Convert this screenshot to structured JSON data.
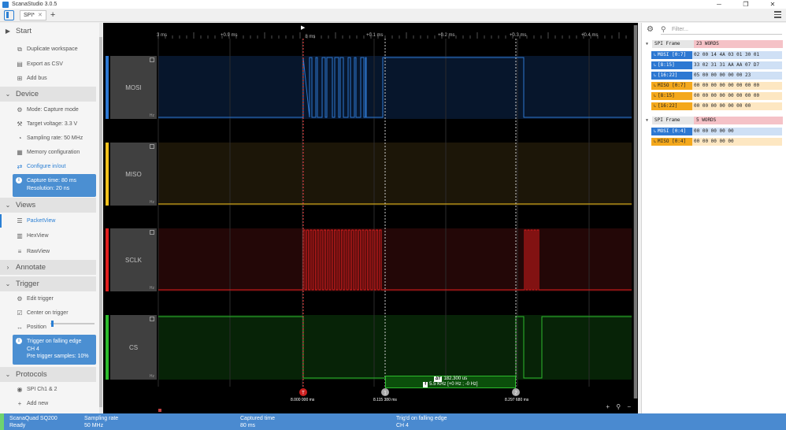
{
  "window": {
    "title": "ScanaStudio 3.0.5",
    "tab_label": "SPI*",
    "tab_close": "✕",
    "add_tab": "+",
    "minimize": "─",
    "maximize": "❐",
    "close": "✕"
  },
  "sidebar": {
    "start": {
      "title": "Start"
    },
    "start_items": [
      {
        "label": "Duplicate workspace",
        "icon": "duplicate-icon"
      },
      {
        "label": "Export as CSV",
        "icon": "export-icon"
      },
      {
        "label": "Add bus",
        "icon": "bus-icon"
      }
    ],
    "device": {
      "title": "Device"
    },
    "device_items": [
      {
        "label": "Mode: Capture mode",
        "icon": "gear-icon"
      },
      {
        "label": "Target voltage: 3.3 V",
        "icon": "voltage-icon"
      },
      {
        "label": "Sampling rate: 50 MHz",
        "icon": "speed-icon"
      },
      {
        "label": "Memory configuration",
        "icon": "memory-icon"
      },
      {
        "label": "Configure in/out",
        "icon": "arrows-icon"
      }
    ],
    "capture_info": {
      "line1": "Capture time: 80 ms",
      "line2": "Resolution: 20 ns"
    },
    "views": {
      "title": "Views"
    },
    "views_items": [
      {
        "label": "PacketView",
        "icon": "list-icon"
      },
      {
        "label": "HexView",
        "icon": "grid-icon"
      },
      {
        "label": "RawView",
        "icon": "raw-icon"
      }
    ],
    "annotate": {
      "title": "Annotate"
    },
    "trigger": {
      "title": "Trigger"
    },
    "trigger_items": [
      {
        "label": "Edit trigger",
        "icon": "gear-icon"
      },
      {
        "label": "Center on trigger",
        "icon": "checkbox-icon"
      },
      {
        "label": "Position",
        "icon": "position-icon"
      }
    ],
    "trigger_position": 0.02,
    "trigger_info": {
      "line1": "Trigger on falling edge",
      "line2": "CH 4",
      "line3": "Pre trigger samples: 10%"
    },
    "protocols": {
      "title": "Protocols"
    },
    "protocols_items": [
      {
        "label": "SPI Ch1 & 2",
        "icon": "eye-icon"
      },
      {
        "label": "Add new",
        "icon": "plus-icon"
      }
    ]
  },
  "ruler": {
    "labels": [
      "3 ms",
      "+0.9 ms",
      "+0.1 ms",
      "+0.2 ms",
      "+0.3 ms",
      "+0.4 ms"
    ],
    "marker": "8 ms"
  },
  "channels": [
    {
      "name": "MOSI",
      "color": "#2d78d2"
    },
    {
      "name": "MISO",
      "color": "#f4c21c"
    },
    {
      "name": "SCLK",
      "color": "#e01e1e"
    },
    {
      "name": "CS",
      "color": "#2dbb2d"
    }
  ],
  "channel_hz": "Hz",
  "markers": {
    "t1": "8.000 000 ms",
    "t2": "8.115 380 ms",
    "t3": "8.297 680 ms",
    "n1": "T",
    "n2": "1",
    "n3": "2"
  },
  "measure": {
    "dt_tag": "ΔT",
    "dt": "182.300 us",
    "freq_tag": "f",
    "freq": "5.5 KHz [+0 Hz ; -0 Hz]"
  },
  "zoom_tools": "+ ⚲ −",
  "packet_view": {
    "filter_placeholder": "Filter...",
    "frames": [
      {
        "label": "SPI Frame",
        "value": "23 WORDS",
        "rows": [
          {
            "kind": "mosi",
            "label": "MOSI [0:7]",
            "value": "02 00 14 4A 03 01 30 01"
          },
          {
            "kind": "mosi",
            "label": "[8:15]",
            "value": "33 02 31 31 AA AA 07 D7"
          },
          {
            "kind": "mosi",
            "label": "[16:22]",
            "value": "05 00 00 00 00 00 23"
          },
          {
            "kind": "miso",
            "label": "MISO [0:7]",
            "value": "00 00 00 00 00 00 00 00"
          },
          {
            "kind": "miso",
            "label": "[8:15]",
            "value": "00 00 00 00 00 00 00 00"
          },
          {
            "kind": "miso",
            "label": "[16:22]",
            "value": "00 00 00 00 00 00 00"
          }
        ]
      },
      {
        "label": "SPI Frame",
        "value": "5 WORDS",
        "rows": [
          {
            "kind": "mosi",
            "label": "MOSI [0:4]",
            "value": "00 00 00 00 00"
          },
          {
            "kind": "miso",
            "label": "MISO [0:4]",
            "value": "00 00 00 00 00"
          }
        ]
      }
    ]
  },
  "status": {
    "device": "ScanaQuad SQ200",
    "state": "Ready",
    "rate_label": "Sampling rate",
    "rate_value": "50 MHz",
    "captured_label": "Captured time",
    "captured_value": "80 ms",
    "trig_label": "Trig'd on falling edge",
    "trig_value": "CH 4"
  }
}
